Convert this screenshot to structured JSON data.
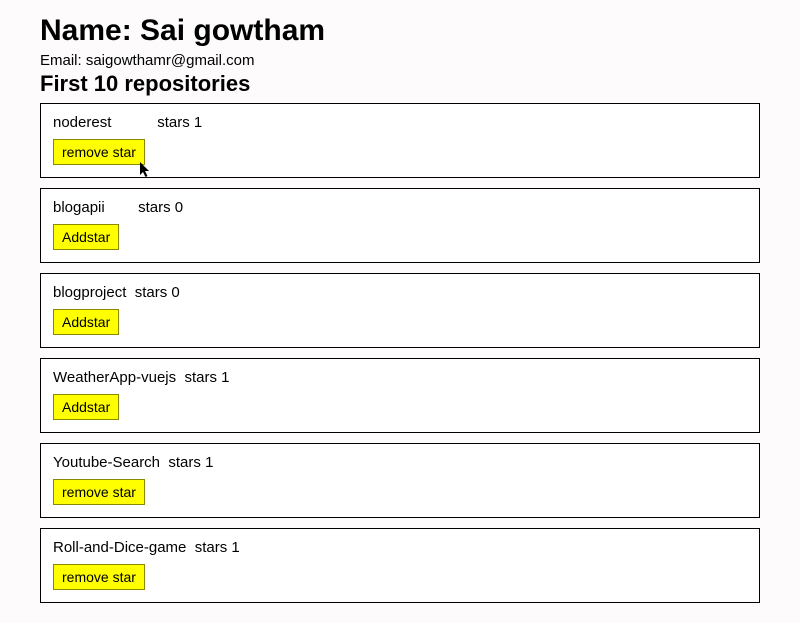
{
  "header": {
    "name_prefix": "Name: ",
    "name": "Sai gowtham",
    "email_prefix": "Email: ",
    "email": "saigowthamr@gmail.com",
    "repos_heading": "First 10 repositories"
  },
  "labels": {
    "stars_word": "stars",
    "add_star": "Addstar",
    "remove_star": "remove star"
  },
  "repos": [
    {
      "name": "noderest",
      "stars": 1,
      "button": "remove star",
      "gap": "           "
    },
    {
      "name": "blogapii",
      "stars": 0,
      "button": "Addstar",
      "gap": "        "
    },
    {
      "name": "blogproject",
      "stars": 0,
      "button": "Addstar",
      "gap": "  "
    },
    {
      "name": "WeatherApp-vuejs",
      "stars": 1,
      "button": "Addstar",
      "gap": "  "
    },
    {
      "name": "Youtube-Search",
      "stars": 1,
      "button": "remove star",
      "gap": "  "
    },
    {
      "name": "Roll-and-Dice-game",
      "stars": 1,
      "button": "remove star",
      "gap": "  "
    }
  ]
}
